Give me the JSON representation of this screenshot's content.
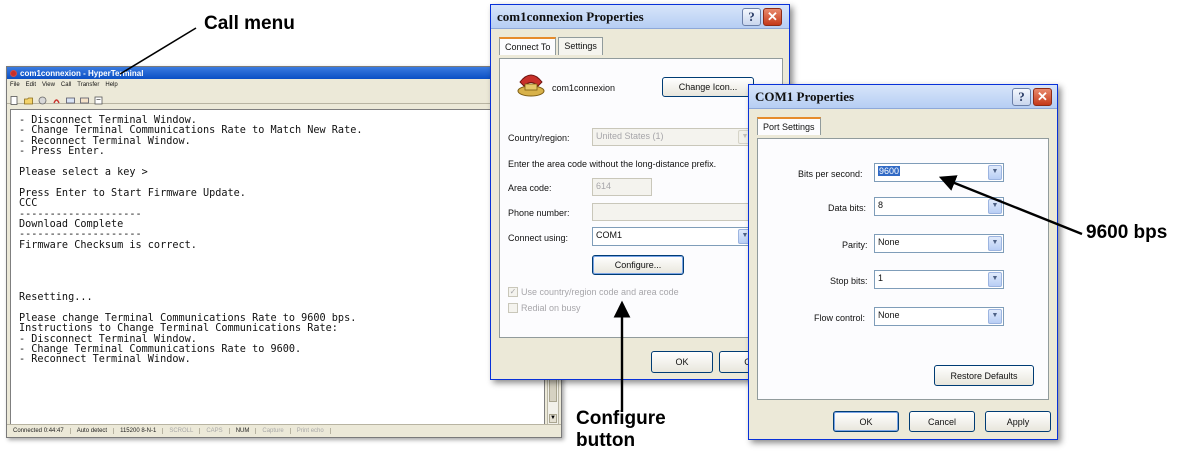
{
  "callouts": {
    "call_menu": "Call menu",
    "configure_button": "Configure button",
    "bps": "9600 bps"
  },
  "hyperterminal": {
    "title": "com1connexion - HyperTerminal",
    "menu": [
      "File",
      "Edit",
      "View",
      "Call",
      "Transfer",
      "Help"
    ],
    "terminal_lines": [
      "- Disconnect Terminal Window.",
      "- Change Terminal Communications Rate to Match New Rate.",
      "- Reconnect Terminal Window.",
      "- Press Enter.",
      "",
      "Please select a key >",
      "",
      "Press Enter to Start Firmware Update.",
      "CCC",
      "--------------------",
      "Download Complete",
      "--------------------",
      "Firmware Checksum is correct.",
      "",
      "",
      "",
      "",
      "Resetting...",
      "",
      "Please change Terminal Communications Rate to 9600 bps.",
      "Instructions to Change Terminal Communications Rate:",
      "- Disconnect Terminal Window.",
      "- Change Terminal Communications Rate to 9600.",
      "- Reconnect Terminal Window."
    ],
    "status": {
      "connected": "Connected 0:44:47",
      "detect": "Auto detect",
      "port": "115200 8-N-1",
      "scroll": "SCROLL",
      "caps": "CAPS",
      "num": "NUM",
      "capture": "Capture",
      "print": "Print echo"
    }
  },
  "com1connexion_props": {
    "title": "com1connexion Properties",
    "tabs": [
      "Connect To",
      "Settings"
    ],
    "connection_name": "com1connexion",
    "change_icon": "Change Icon...",
    "country_label": "Country/region:",
    "country_value": "United States (1)",
    "area_prompt": "Enter the area code without the long-distance prefix.",
    "area_label": "Area code:",
    "area_value": "614",
    "phone_label": "Phone number:",
    "phone_value": "",
    "connect_label": "Connect using:",
    "connect_value": "COM1",
    "configure": "Configure...",
    "use_country": "Use country/region code and area code",
    "redial": "Redial on busy",
    "ok": "OK",
    "cancel": "Ca"
  },
  "com1_props": {
    "title": "COM1 Properties",
    "tab": "Port Settings",
    "bits_label": "Bits per second:",
    "bits_value": "9600",
    "data_label": "Data bits:",
    "data_value": "8",
    "parity_label": "Parity:",
    "parity_value": "None",
    "stop_label": "Stop bits:",
    "stop_value": "1",
    "flow_label": "Flow control:",
    "flow_value": "None",
    "restore": "Restore Defaults",
    "ok": "OK",
    "cancel": "Cancel",
    "apply": "Apply"
  },
  "colors": {
    "xp_face": "#ece9d8",
    "xp_border_blue": "#0831d9",
    "close_red": "#c5391a",
    "tab_highlight": "#e68b2c"
  }
}
